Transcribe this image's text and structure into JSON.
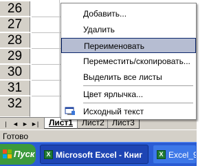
{
  "rows": [
    "26",
    "27",
    "28",
    "29",
    "30",
    "31",
    "32"
  ],
  "sheet_tabs": [
    "Лист1",
    "Лист2",
    "Лист3"
  ],
  "nav_buttons": [
    "|◄",
    "◄",
    "►",
    "►|"
  ],
  "status": "Готово",
  "taskbar": {
    "start_label": "Пуск",
    "tasks": [
      {
        "label": "Microsoft Excel - Книг"
      },
      {
        "label": "Excel_9 -"
      }
    ]
  },
  "menu": {
    "items": [
      {
        "label": "Добавить..."
      },
      {
        "label": "Удалить"
      },
      {
        "label": "Переименовать"
      },
      {
        "label": "Переместить/скопировать..."
      },
      {
        "label": "Выделить все листы"
      },
      {
        "label": "Цвет ярлычка..."
      },
      {
        "label": "Исходный текст"
      }
    ]
  }
}
